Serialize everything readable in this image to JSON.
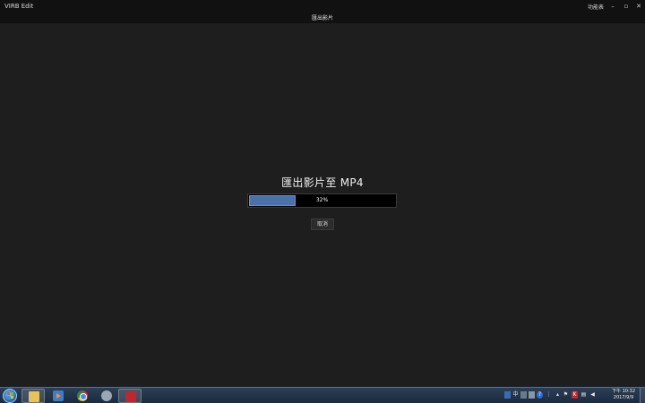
{
  "window": {
    "app_title": "VIRB Edit",
    "page_title": "匯出影片",
    "menu_label": "功能表",
    "minimize_glyph": "–",
    "maximize_glyph": "▫",
    "close_glyph": "✕"
  },
  "export": {
    "heading": "匯出影片至 MP4",
    "progress_percent": 32,
    "progress_label": "32%",
    "cancel_label": "取消",
    "accent_color": "#4a72a8"
  },
  "taskbar": {
    "start_icon": "windows-start-icon",
    "apps": [
      {
        "name": "file-explorer-icon",
        "active": true
      },
      {
        "name": "media-player-icon",
        "active": false
      },
      {
        "name": "chrome-icon",
        "active": false
      },
      {
        "name": "tool-icon",
        "active": false
      },
      {
        "name": "virb-edit-icon",
        "active": true
      }
    ],
    "tray": {
      "ime_indicator": "中",
      "help_glyph": "?",
      "antivirus_glyph": "K"
    },
    "clock": {
      "time": "下午 10:32",
      "date": "2017/9/9"
    }
  }
}
